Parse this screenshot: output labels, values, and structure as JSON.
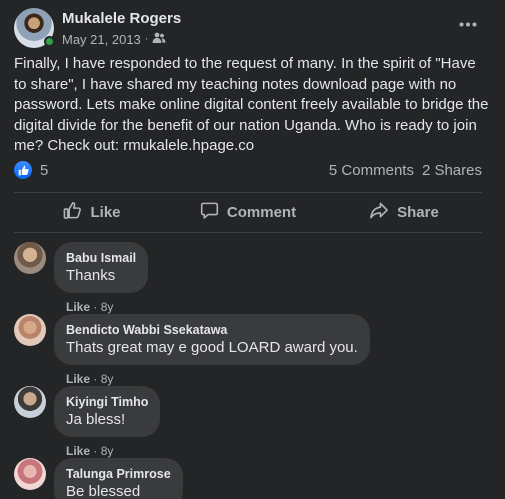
{
  "post": {
    "author": "Mukalele Rogers",
    "date": "May 21, 2013",
    "dot": "·",
    "audience_icon": "friends-icon",
    "more_icon": "more-horizontal-icon",
    "text": "Finally, I have responded to the request of many. In the spirit of \"Have to share\", I have shared my teaching notes download page with no password. Lets make online digital content freely available to bridge the digital divide for the benefit of our nation Uganda. Who is ready to join me? Check out: rmukalele.hpage.co"
  },
  "reactions": {
    "count": "5",
    "comments": "5 Comments",
    "shares": "2 Shares"
  },
  "actions": {
    "like": "Like",
    "comment": "Comment",
    "share": "Share"
  },
  "comments": [
    {
      "name": "Babu Ismail",
      "text": "Thanks",
      "like": "Like",
      "sep": "·",
      "age": "8y"
    },
    {
      "name": "Bendicto Wabbi Ssekatawa",
      "text": "Thats great may e good LOARD award you.",
      "like": "Like",
      "sep": "·",
      "age": "8y"
    },
    {
      "name": "Kiyingi Timho",
      "text": "Ja bless!",
      "like": "Like",
      "sep": "·",
      "age": "8y"
    },
    {
      "name": "Talunga Primrose",
      "text": "Be blessed"
    }
  ],
  "colors": {
    "background": "#242526",
    "bubble": "#3a3b3c",
    "primary_text": "#e4e6eb",
    "secondary_text": "#b0b3b8",
    "like_blue": "#0866ff",
    "online_green": "#31a24c"
  }
}
